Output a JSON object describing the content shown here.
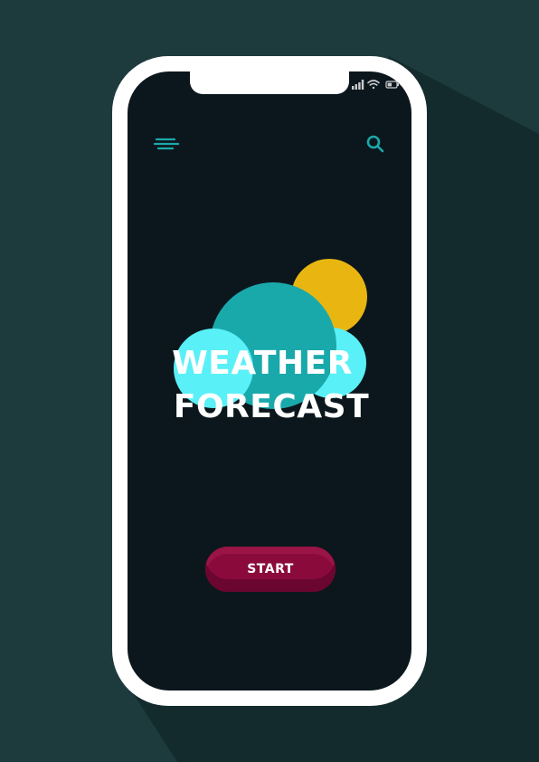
{
  "app": {
    "title_line1": "WEATHER",
    "title_line2": "FORECAST",
    "start_label": "START"
  },
  "header": {
    "menu_icon": "menu-icon",
    "search_icon": "search-icon"
  },
  "status_bar": {
    "icons": [
      "signal-icon",
      "wifi-icon",
      "battery-icon"
    ]
  },
  "colors": {
    "background": "#1d3b3d",
    "shadow": "#142b2d",
    "phone_frame": "#ffffff",
    "screen": "#0c171d",
    "accent_teal": "#1aa9ab",
    "cloud_light": "#59f0f7",
    "sun": "#e9b611",
    "button": "#8a0b3b"
  }
}
